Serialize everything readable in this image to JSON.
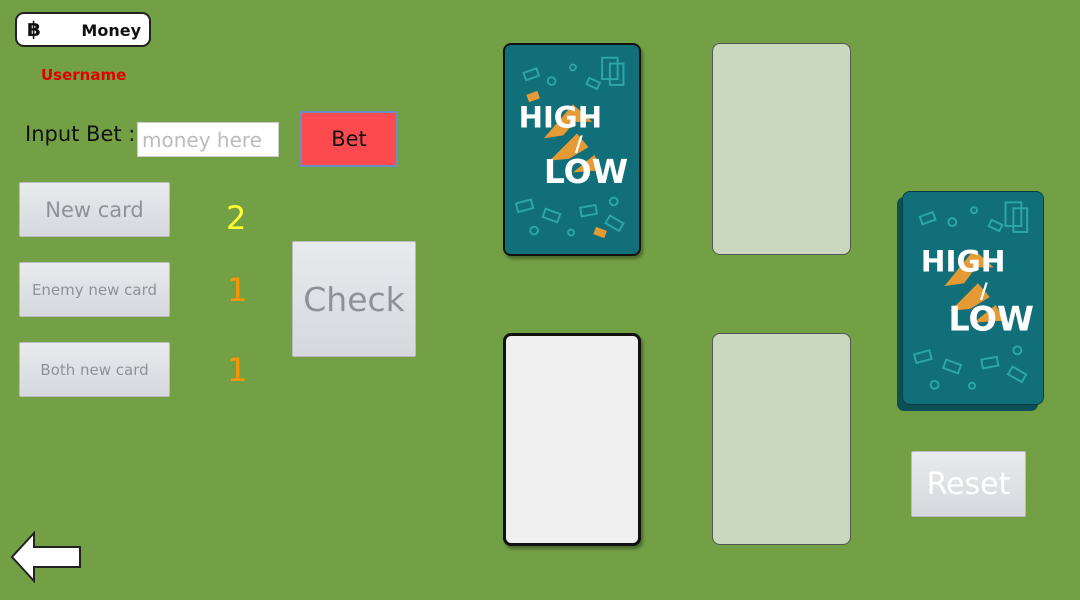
{
  "header": {
    "currency_symbol": "฿",
    "money_label": "Money",
    "username": "Username"
  },
  "bet": {
    "label": "Input Bet :",
    "placeholder": "money here",
    "button_label": "Bet"
  },
  "controls": {
    "new_card": "New card",
    "enemy_new_card": "Enemy new card",
    "both_new_card": "Both new card",
    "check": "Check",
    "reset": "Reset"
  },
  "counts": {
    "new_card": "2",
    "enemy_new_card": "1",
    "both_new_card": "1"
  },
  "card_back": {
    "line1": "HIGH",
    "line2": "/",
    "line3": "LOW"
  },
  "colors": {
    "table": "#73a045",
    "card_back": "#116f79",
    "bet_button": "#fd4a4f",
    "username": "#e10000"
  },
  "icons": {
    "back": "back-arrow-icon",
    "currency": "baht-icon"
  }
}
